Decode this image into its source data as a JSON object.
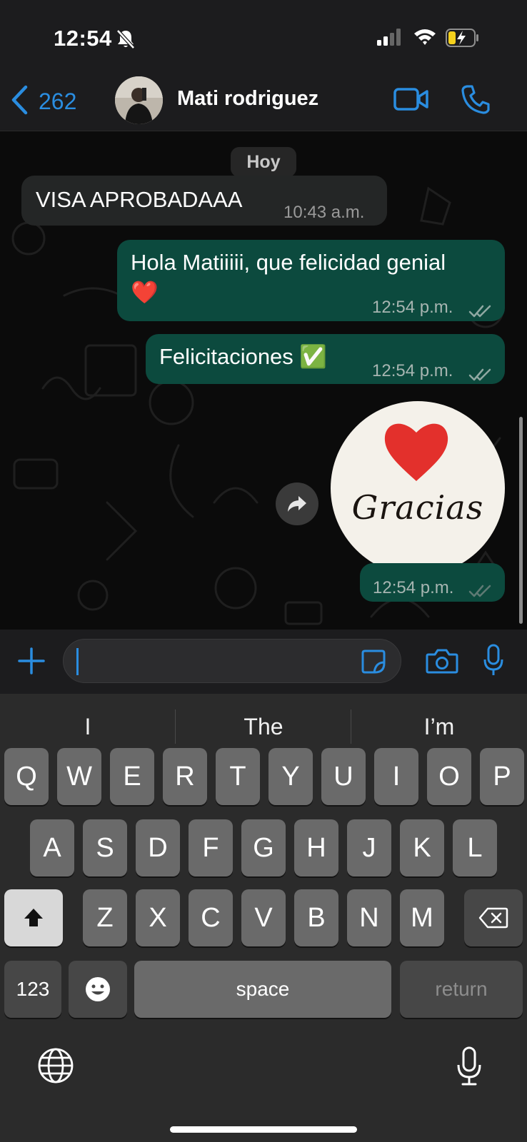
{
  "status_bar": {
    "time": "12:54",
    "icons": [
      "bell-slash-icon",
      "cellular-signal-icon",
      "wifi-icon",
      "battery-charging-icon"
    ]
  },
  "header": {
    "back_count": "262",
    "contact_name": "Mati rodriguez",
    "icons": [
      "chevron-left-icon",
      "video-camera-icon",
      "phone-icon"
    ]
  },
  "chat": {
    "date_chip": "Hoy",
    "messages": [
      {
        "direction": "incoming",
        "text": "VISA APROBADAAA",
        "time": "10:43 a.m."
      },
      {
        "direction": "outgoing",
        "text_line1": "Hola Matiiiii, que felicidad genial",
        "text_line2": "❤️",
        "time": "12:54 p.m.",
        "status": "read"
      },
      {
        "direction": "outgoing",
        "text": "Felicitaciones ✅",
        "time": "12:54 p.m.",
        "status": "read"
      },
      {
        "direction": "outgoing",
        "type": "sticker",
        "sticker_text": "Gracias",
        "time": "12:54 p.m.",
        "status": "read"
      }
    ]
  },
  "composer": {
    "placeholder": "",
    "icons": [
      "plus-icon",
      "sticker-icon",
      "camera-icon",
      "microphone-icon"
    ]
  },
  "keyboard": {
    "suggestions": [
      "I",
      "The",
      "I’m"
    ],
    "row1": [
      "Q",
      "W",
      "E",
      "R",
      "T",
      "Y",
      "U",
      "I",
      "O",
      "P"
    ],
    "row2": [
      "A",
      "S",
      "D",
      "F",
      "G",
      "H",
      "J",
      "K",
      "L"
    ],
    "row3": [
      "Z",
      "X",
      "C",
      "V",
      "B",
      "N",
      "M"
    ],
    "numbers_label": "123",
    "space_label": "space",
    "return_label": "return"
  },
  "colors": {
    "accent": "#2a8de0",
    "outgoing_bubble": "#0c4a3e",
    "incoming_bubble": "#242626"
  }
}
